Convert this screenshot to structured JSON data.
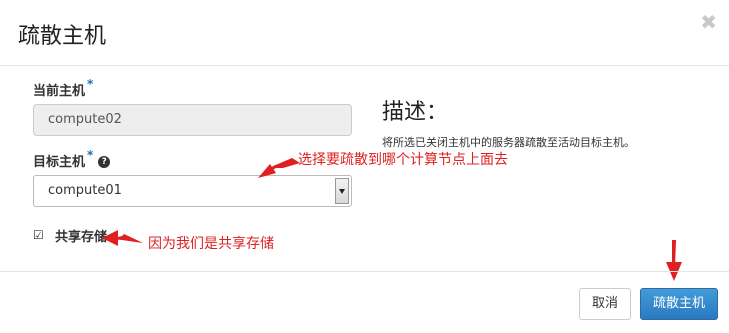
{
  "dialog": {
    "title": "疏散主机",
    "close_glyph": "✖"
  },
  "form": {
    "current_host_label": "当前主机",
    "current_host_value": "compute02",
    "required_mark": "*",
    "target_host_label": "目标主机",
    "target_host_value": "compute01",
    "help_glyph": "?",
    "shared_storage_label": "共享存储",
    "shared_storage_checked": true,
    "checkbox_glyph": "☑"
  },
  "description": {
    "title": "描述：",
    "text": "将所选已关闭主机中的服务器疏散至活动目标主机。"
  },
  "annotations": {
    "select_note": "选择要疏散到哪个计算节点上面去",
    "storage_note": "因为我们是共享存储"
  },
  "footer": {
    "cancel_label": "取消",
    "submit_label": "疏散主机"
  },
  "colors": {
    "annotation_red": "#e02020",
    "primary_blue": "#2a7ac0",
    "required_blue": "#1e6eb4"
  }
}
